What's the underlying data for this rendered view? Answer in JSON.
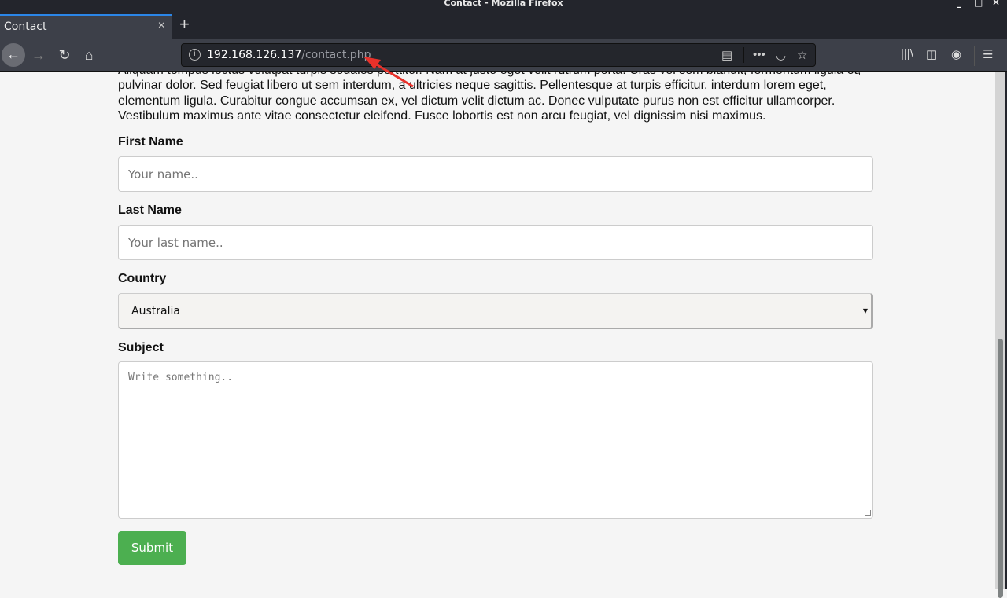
{
  "window": {
    "title": "Contact - Mozilla Firefox"
  },
  "tab": {
    "label": "Contact",
    "close": "×",
    "new_tab": "+"
  },
  "urlbar": {
    "host": "192.168.126.137",
    "path": "/contact.php"
  },
  "page": {
    "paragraph": "Aliquam tempus lectus volutpat turpis sodales porttitor. Nam at justo eget velit rutrum porta. Cras vel sem blandit, fermentum ligula et, pulvinar dolor. Sed feugiat libero ut sem interdum, a ultricies neque sagittis. Pellentesque at turpis efficitur, interdum lorem eget, elementum ligula. Curabitur congue accumsan ex, vel dictum velit dictum ac. Donec vulputate purus non est efficitur ullamcorper. Vestibulum maximus ante vitae consectetur eleifend. Fusce lobortis est non arcu feugiat, vel dignissim nisi maximus.",
    "form": {
      "first_name_label": "First Name",
      "first_name_placeholder": "Your name..",
      "last_name_label": "Last Name",
      "last_name_placeholder": "Your last name..",
      "country_label": "Country",
      "country_value": "Australia",
      "subject_label": "Subject",
      "subject_placeholder": "Write something..",
      "submit_label": "Submit"
    }
  },
  "colors": {
    "submit": "#4caf50",
    "annotation_arrow": "#e8312a"
  }
}
